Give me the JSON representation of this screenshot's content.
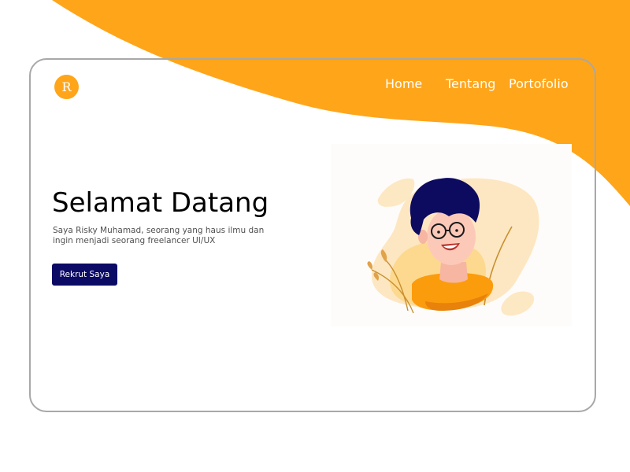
{
  "logo": {
    "letter": "R"
  },
  "nav": {
    "home": "Home",
    "about": "Tentang",
    "portfolio": "Portofolio"
  },
  "hero": {
    "title": "Selamat Datang",
    "description": "Saya Risky Muhamad, seorang yang haus ilmu dan ingin menjadi seorang freelancer UI/UX",
    "button_label": "Rekrut Saya"
  },
  "colors": {
    "accent": "#ffa51a",
    "button": "#0b0a65",
    "frame_border": "#a8a8a8"
  }
}
